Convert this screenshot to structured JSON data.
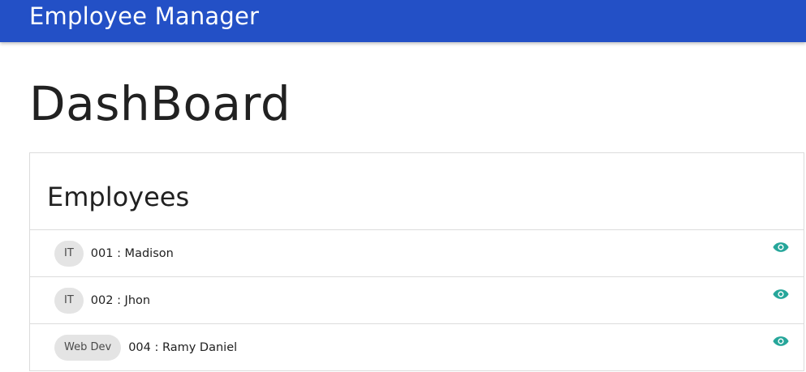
{
  "header": {
    "app_title": "Employee Manager",
    "brand_color": "#2350c6"
  },
  "page": {
    "title": "DashBoard"
  },
  "employees_card": {
    "title": "Employees",
    "icon_color": "#26a69a",
    "rows": [
      {
        "department": "IT",
        "label": "001 : Madison",
        "action_icon": "eye-icon"
      },
      {
        "department": "IT",
        "label": "002 : Jhon",
        "action_icon": "eye-icon"
      },
      {
        "department": "Web Dev",
        "label": "004 : Ramy Daniel",
        "action_icon": "eye-icon"
      }
    ]
  }
}
